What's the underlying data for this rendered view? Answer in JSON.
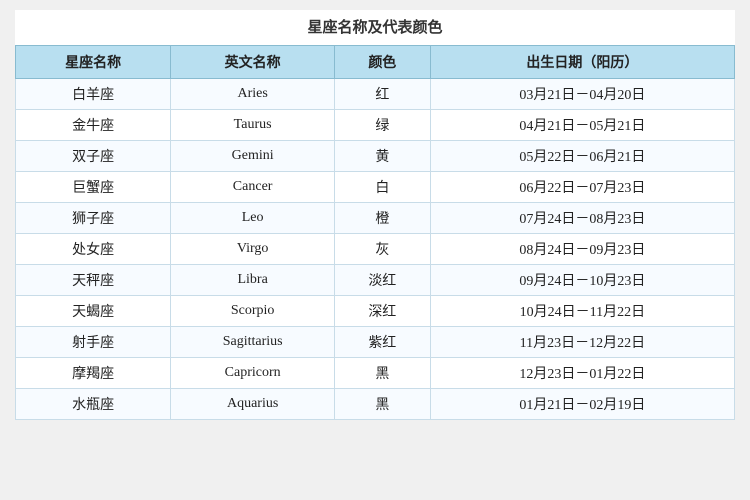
{
  "title": "星座名称及代表颜色",
  "columns": [
    "星座名称",
    "英文名称",
    "颜色",
    "出生日期（阳历）"
  ],
  "rows": [
    {
      "chinese": "白羊座",
      "english": "Aries",
      "color": "红",
      "dates": "03月21日－04月20日"
    },
    {
      "chinese": "金牛座",
      "english": "Taurus",
      "color": "绿",
      "dates": "04月21日－05月21日"
    },
    {
      "chinese": "双子座",
      "english": "Gemini",
      "color": "黄",
      "dates": "05月22日－06月21日"
    },
    {
      "chinese": "巨蟹座",
      "english": "Cancer",
      "color": "白",
      "dates": "06月22日－07月23日"
    },
    {
      "chinese": "狮子座",
      "english": "Leo",
      "color": "橙",
      "dates": "07月24日－08月23日"
    },
    {
      "chinese": "处女座",
      "english": "Virgo",
      "color": "灰",
      "dates": "08月24日－09月23日"
    },
    {
      "chinese": "天秤座",
      "english": "Libra",
      "color": "淡红",
      "dates": "09月24日－10月23日"
    },
    {
      "chinese": "天蝎座",
      "english": "Scorpio",
      "color": "深红",
      "dates": "10月24日－11月22日"
    },
    {
      "chinese": "射手座",
      "english": "Sagittarius",
      "color": "紫红",
      "dates": "11月23日－12月22日"
    },
    {
      "chinese": "摩羯座",
      "english": "Capricorn",
      "color": "黑",
      "dates": "12月23日－01月22日"
    },
    {
      "chinese": "水瓶座",
      "english": "Aquarius",
      "color": "黑",
      "dates": "01月21日－02月19日"
    }
  ]
}
